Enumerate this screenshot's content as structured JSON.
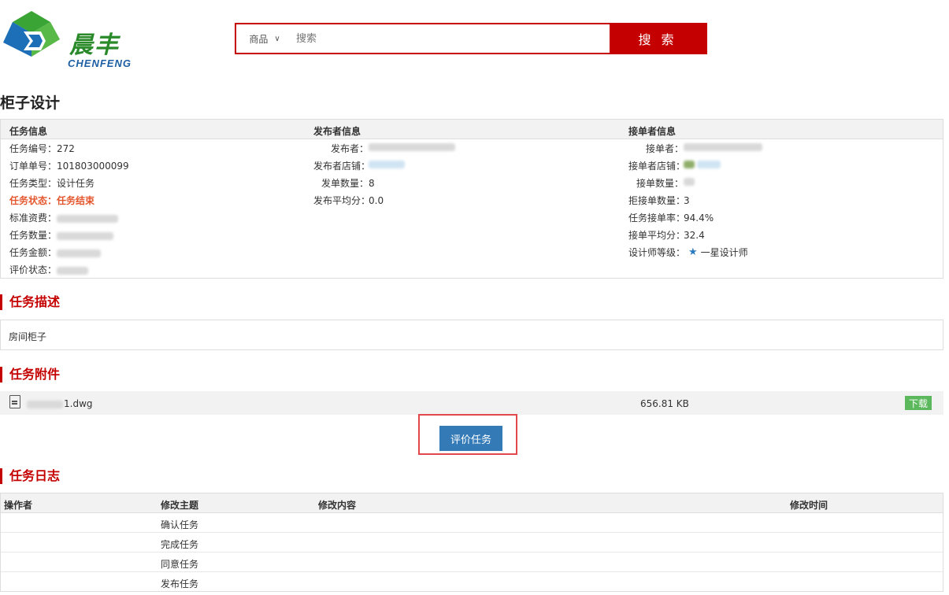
{
  "header": {
    "logo_cn": "晨丰",
    "logo_en": "CHENFENG",
    "search": {
      "category": "商品",
      "placeholder": "搜索",
      "button_label": "搜 索"
    }
  },
  "page_title": "柜子设计",
  "info": {
    "headers": {
      "task": "任务信息",
      "publisher": "发布者信息",
      "receiver": "接单者信息"
    },
    "task": {
      "id_label": "任务编号：",
      "id_value": "272",
      "order_label": "订单单号：",
      "order_value": "101803000099",
      "type_label": "任务类型：",
      "type_value": "设计任务",
      "status_label": "任务状态：",
      "status_value": "任务结束",
      "fee_label": "标准资费：",
      "qty_label": "任务数量：",
      "amount_label": "任务金额：",
      "eval_label": "评价状态："
    },
    "publisher": {
      "name_label": "发布者：",
      "shop_label": "发布者店铺：",
      "count_label": "发单数量：",
      "count_value": "8",
      "avg_label": "发布平均分：",
      "avg_value": "0.0"
    },
    "receiver": {
      "name_label": "接单者：",
      "shop_label": "接单者店铺：",
      "count_label": "接单数量：",
      "reject_label": "拒接单数量：",
      "reject_value": "3",
      "rate_label": "任务接单率：",
      "rate_value": "94.4%",
      "avg_label": "接单平均分：",
      "avg_value": "32.4",
      "level_label": "设计师等级：",
      "level_value": "一星设计师"
    }
  },
  "description": {
    "title": "任务描述",
    "text": "房间柜子"
  },
  "attachments": {
    "title": "任务附件",
    "file_name_suffix": "1.dwg",
    "file_size": "656.81 KB",
    "download_label": "下载"
  },
  "evaluate_button": "评价任务",
  "log": {
    "title": "任务日志",
    "headers": {
      "operator": "操作者",
      "subject": "修改主题",
      "content": "修改内容",
      "time": "修改时间"
    },
    "rows": [
      {
        "subject": "确认任务"
      },
      {
        "subject": "完成任务"
      },
      {
        "subject": "同意任务"
      },
      {
        "subject": "发布任务"
      }
    ]
  },
  "colors": {
    "brand_red": "#c40000",
    "primary_blue": "#337ab7",
    "download_green": "#5cb85c",
    "status_orange": "#e4572e"
  }
}
